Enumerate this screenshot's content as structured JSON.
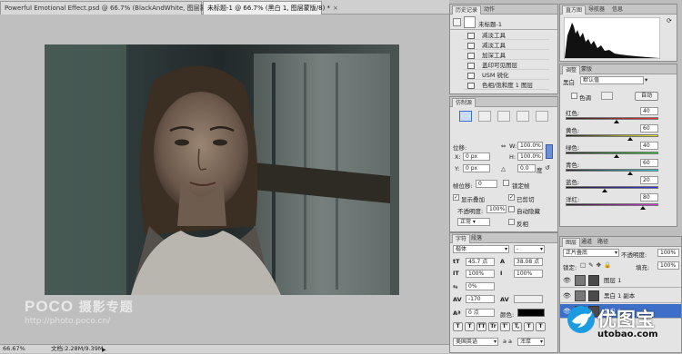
{
  "document_tabs": [
    {
      "label": "Powerful Emotional Effect.psd @ 66.7% (BlackAndWhite, 图层蒙版/8) *",
      "active": false
    },
    {
      "label": "未标题-1 @ 66.7% (黑白 1, 图层蒙版/8) *",
      "active": true
    }
  ],
  "status": {
    "zoom": "66.67%",
    "doc_label": "文档:2.28M/9.39M"
  },
  "watermark": {
    "brand": "POCO",
    "tagline": "摄影专题",
    "url": "http://photo.poco.cn/"
  },
  "site_logo": {
    "name": "优图宝",
    "url": "utobao.com"
  },
  "history_panel": {
    "tabs": [
      "历史记录",
      "动作"
    ],
    "snapshot": "未标题-1",
    "items": [
      "减淡工具",
      "减淡工具",
      "加深工具",
      "盖印可见图层",
      "USM 锐化",
      "色相/饱和度 1 图层"
    ]
  },
  "histogram_panel": {
    "tabs": [
      "直方图",
      "导航器",
      "信息"
    ]
  },
  "adjustments_panel": {
    "tabs": [
      "调整",
      "蒙版"
    ],
    "title": "黑白",
    "preset": "默认值",
    "tint_label": "色调",
    "auto_label": "自动",
    "sliders": [
      {
        "label": "红色:",
        "value": "40",
        "pos": 0.55,
        "gradient": "linear-gradient(90deg,#222,#f33)"
      },
      {
        "label": "黄色:",
        "value": "60",
        "pos": 0.7,
        "gradient": "linear-gradient(90deg,#222,#ee2)"
      },
      {
        "label": "绿色:",
        "value": "40",
        "pos": 0.55,
        "gradient": "linear-gradient(90deg,#222,#3c3)"
      },
      {
        "label": "青色:",
        "value": "60",
        "pos": 0.7,
        "gradient": "linear-gradient(90deg,#222,#3cd)"
      },
      {
        "label": "蓝色:",
        "value": "20",
        "pos": 0.42,
        "gradient": "linear-gradient(90deg,#222,#33e)"
      },
      {
        "label": "洋红:",
        "value": "80",
        "pos": 0.83,
        "gradient": "linear-gradient(90deg,#222,#d3d)"
      }
    ]
  },
  "clone_source_panel": {
    "tabs": [
      "仿制源"
    ],
    "offset_label": "位移:",
    "x_label": "X:",
    "x_value": "0 px",
    "y_label": "Y:",
    "y_value": "0 px",
    "w_label": "W:",
    "w_value": "100.0%",
    "h_label": "H:",
    "h_value": "100.0%",
    "angle_value": "0.0",
    "angle_unit": "度",
    "frame_offset_label": "帧位移:",
    "frame_offset_value": "0",
    "lock_frame_label": "锁定帧",
    "show_overlay_label": "显示叠加",
    "clipped_label": "已剪切",
    "opacity_label": "不透明度:",
    "opacity_value": "100%",
    "auto_hide_label": "自动隐藏",
    "mode_value": "正常",
    "invert_label": "反相"
  },
  "character_panel": {
    "tabs": [
      "字符",
      "段落"
    ],
    "font": "楷体",
    "font_style": "-",
    "size": "45.7 点",
    "leading": "38.08 点",
    "vscale": "100%",
    "hscale": "100%",
    "tracking_pct": "0%",
    "tracking": "-170",
    "kerning": "",
    "baseline": "0 点",
    "color_label": "颜色:",
    "language": "美国英语",
    "antialias": "浑厚",
    "aa_label": "a a",
    "style_buttons": [
      "T",
      "T",
      "TT",
      "Tr",
      "T'",
      "T,",
      "T",
      "T"
    ]
  },
  "layers_panel": {
    "tabs": [
      "图层",
      "通道",
      "路径"
    ],
    "blend_mode": "正片叠底",
    "opacity_label": "不透明度:",
    "opacity": "100%",
    "lock_label": "锁定:",
    "fill_label": "填充:",
    "fill": "100%",
    "layers": [
      {
        "name": "图层 1",
        "selected": false
      },
      {
        "name": "黑白 1 副本",
        "selected": false
      },
      {
        "name": "黑白 1",
        "selected": true
      }
    ]
  }
}
